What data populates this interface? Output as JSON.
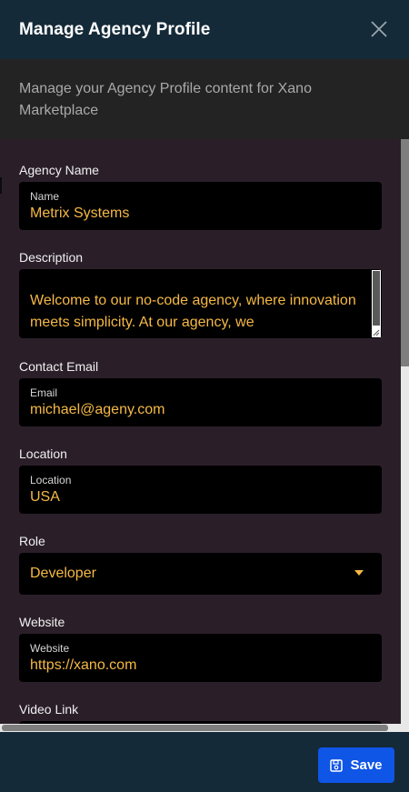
{
  "header": {
    "title": "Manage Agency Profile",
    "close_icon": "close-icon"
  },
  "subheader": {
    "text": "Manage your Agency Profile content for Xano Marketplace"
  },
  "form": {
    "agency_name": {
      "label": "Agency Name",
      "inner_label": "Name",
      "value": "Metrix Systems"
    },
    "description": {
      "label": "Description",
      "value": "Welcome to our no-code agency, where innovation meets simplicity. At our agency, we"
    },
    "contact_email": {
      "label": "Contact Email",
      "inner_label": "Email",
      "value": "michael@ageny.com"
    },
    "location": {
      "label": "Location",
      "inner_label": "Location",
      "value": "USA"
    },
    "role": {
      "label": "Role",
      "value": "Developer"
    },
    "website": {
      "label": "Website",
      "inner_label": "Website",
      "value": "https://xano.com"
    },
    "video_link": {
      "label": "Video Link"
    }
  },
  "footer": {
    "save_label": "Save",
    "save_icon": "floppy-disk-icon"
  },
  "colors": {
    "header_bg": "#152a38",
    "content_bg": "#2a1f29",
    "value_text": "#f5b945",
    "primary_button": "#0f55e6"
  }
}
